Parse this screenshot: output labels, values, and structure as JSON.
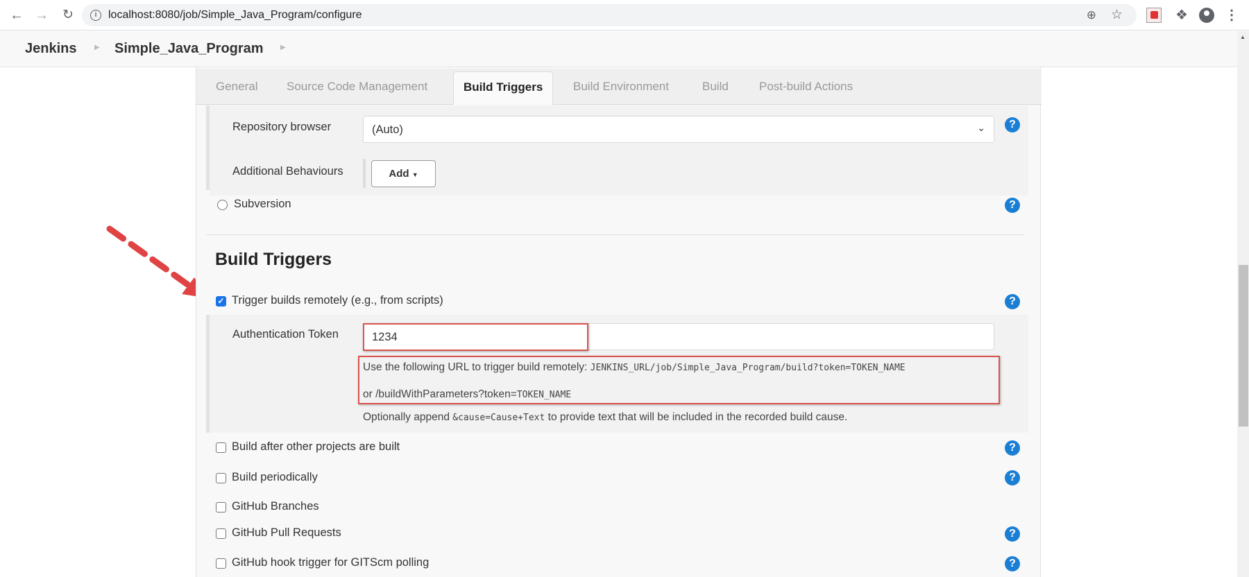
{
  "browser": {
    "url": "localhost:8080/job/Simple_Java_Program/configure",
    "nav": {
      "back": "←",
      "forward": "→",
      "reload": "C"
    }
  },
  "breadcrumb": {
    "items": [
      "Jenkins",
      "Simple_Java_Program"
    ]
  },
  "tabs": [
    {
      "label": "General",
      "active": false
    },
    {
      "label": "Source Code Management",
      "active": false
    },
    {
      "label": "Build Triggers",
      "active": true
    },
    {
      "label": "Build Environment",
      "active": false
    },
    {
      "label": "Build",
      "active": false
    },
    {
      "label": "Post-build Actions",
      "active": false
    }
  ],
  "scm": {
    "repository_browser_label": "Repository browser",
    "repository_browser_value": "(Auto)",
    "additional_behaviours_label": "Additional Behaviours",
    "add_button_label": "Add",
    "subversion_label": "Subversion",
    "subversion_selected": false
  },
  "build_triggers": {
    "heading": "Build Triggers",
    "trigger_remote": {
      "label": "Trigger builds remotely (e.g., from scripts)",
      "checked": true,
      "auth_token_label": "Authentication Token",
      "auth_token_value": "1234",
      "url_help_prefix": "Use the following URL to trigger build remotely: ",
      "url_help_code": "JENKINS_URL/job/Simple_Java_Program/build?token=TOKEN_NAME",
      "url_help_line2_prefix": "or /buildWithParameters?token=",
      "url_help_line2_code": "TOKEN_NAME",
      "optional_prefix": "Optionally append ",
      "optional_code": "&cause=Cause+Text",
      "optional_suffix": " to provide text that will be included in the recorded build cause."
    },
    "options": [
      {
        "label": "Build after other projects are built",
        "checked": false,
        "help": true
      },
      {
        "label": "Build periodically",
        "checked": false,
        "help": true
      },
      {
        "label": "GitHub Branches",
        "checked": false,
        "help": false
      },
      {
        "label": "GitHub Pull Requests",
        "checked": false,
        "help": true
      },
      {
        "label": "GitHub hook trigger for GITScm polling",
        "checked": false,
        "help": true
      }
    ]
  },
  "colors": {
    "annotation_red": "#d9534f",
    "help_blue": "#1a7fd4",
    "checkbox_blue": "#1a73e8"
  }
}
